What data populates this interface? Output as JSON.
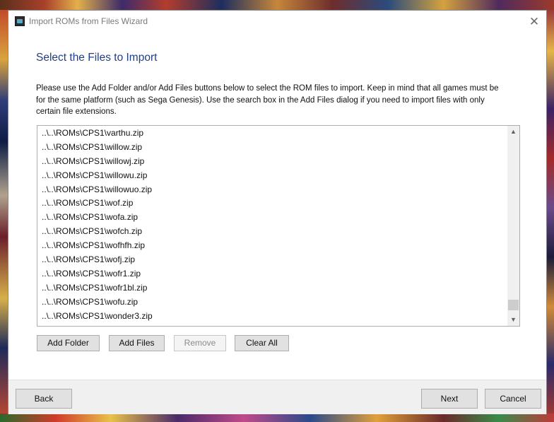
{
  "window": {
    "title": "Import ROMs from Files Wizard"
  },
  "page": {
    "heading": "Select the Files to Import",
    "instructions": [
      "Please use the Add Folder and/or Add Files buttons below to select the ROM files to import. Keep in mind that all games must be",
      "for the same platform (such as Sega Genesis). Use the search box in the Add Files dialog if you need to import files with only",
      "certain file extensions."
    ]
  },
  "file_list": {
    "items": [
      "..\\..\\ROMs\\CPS1\\varthu.zip",
      "..\\..\\ROMs\\CPS1\\willow.zip",
      "..\\..\\ROMs\\CPS1\\willowj.zip",
      "..\\..\\ROMs\\CPS1\\willowu.zip",
      "..\\..\\ROMs\\CPS1\\willowuo.zip",
      "..\\..\\ROMs\\CPS1\\wof.zip",
      "..\\..\\ROMs\\CPS1\\wofa.zip",
      "..\\..\\ROMs\\CPS1\\wofch.zip",
      "..\\..\\ROMs\\CPS1\\wofhfh.zip",
      "..\\..\\ROMs\\CPS1\\wofj.zip",
      "..\\..\\ROMs\\CPS1\\wofr1.zip",
      "..\\..\\ROMs\\CPS1\\wofr1bl.zip",
      "..\\..\\ROMs\\CPS1\\wofu.zip",
      "..\\..\\ROMs\\CPS1\\wonder3.zip"
    ],
    "scroll_position": 0.98
  },
  "buttons": {
    "add_folder": "Add Folder",
    "add_files": "Add Files",
    "remove": "Remove",
    "clear_all": "Clear All"
  },
  "footer": {
    "back": "Back",
    "next": "Next",
    "cancel": "Cancel"
  },
  "icons": {
    "app": "app-icon",
    "close": "close-icon",
    "scroll_up": "chevron-up-icon",
    "scroll_down": "chevron-down-icon"
  },
  "colors": {
    "heading": "#1f3f86",
    "button_face": "#e1e1e1",
    "footer": "#f0f0f0"
  }
}
